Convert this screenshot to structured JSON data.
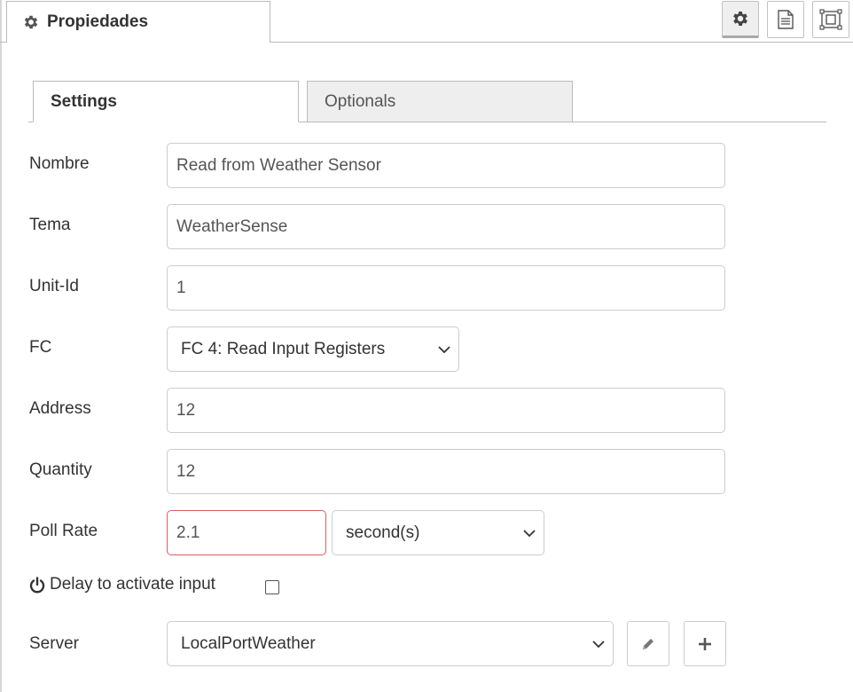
{
  "header": {
    "title": "Propiedades",
    "icons": [
      "gear-icon",
      "document-icon",
      "expand-icon"
    ]
  },
  "tabs": [
    {
      "label": "Settings",
      "active": true
    },
    {
      "label": "Optionals",
      "active": false
    }
  ],
  "form": {
    "name": {
      "label": "Nombre",
      "value": "Read from Weather Sensor"
    },
    "topic": {
      "label": "Tema",
      "value": "WeatherSense"
    },
    "unit_id": {
      "label": "Unit-Id",
      "value": "1"
    },
    "fc": {
      "label": "FC",
      "value": "FC 4: Read Input Registers"
    },
    "address": {
      "label": "Address",
      "value": "12"
    },
    "quantity": {
      "label": "Quantity",
      "value": "12"
    },
    "poll_rate": {
      "label": "Poll Rate",
      "value": "2.1",
      "unit": "second(s)"
    },
    "delay": {
      "label": "Delay to activate input",
      "checked": false
    },
    "server": {
      "label": "Server",
      "value": "LocalPortWeather"
    }
  },
  "colors": {
    "border": "#cccccc",
    "invalid_border": "#d6615e",
    "inactive_tab": "#eeeeee",
    "active_tool": "#efefef"
  }
}
